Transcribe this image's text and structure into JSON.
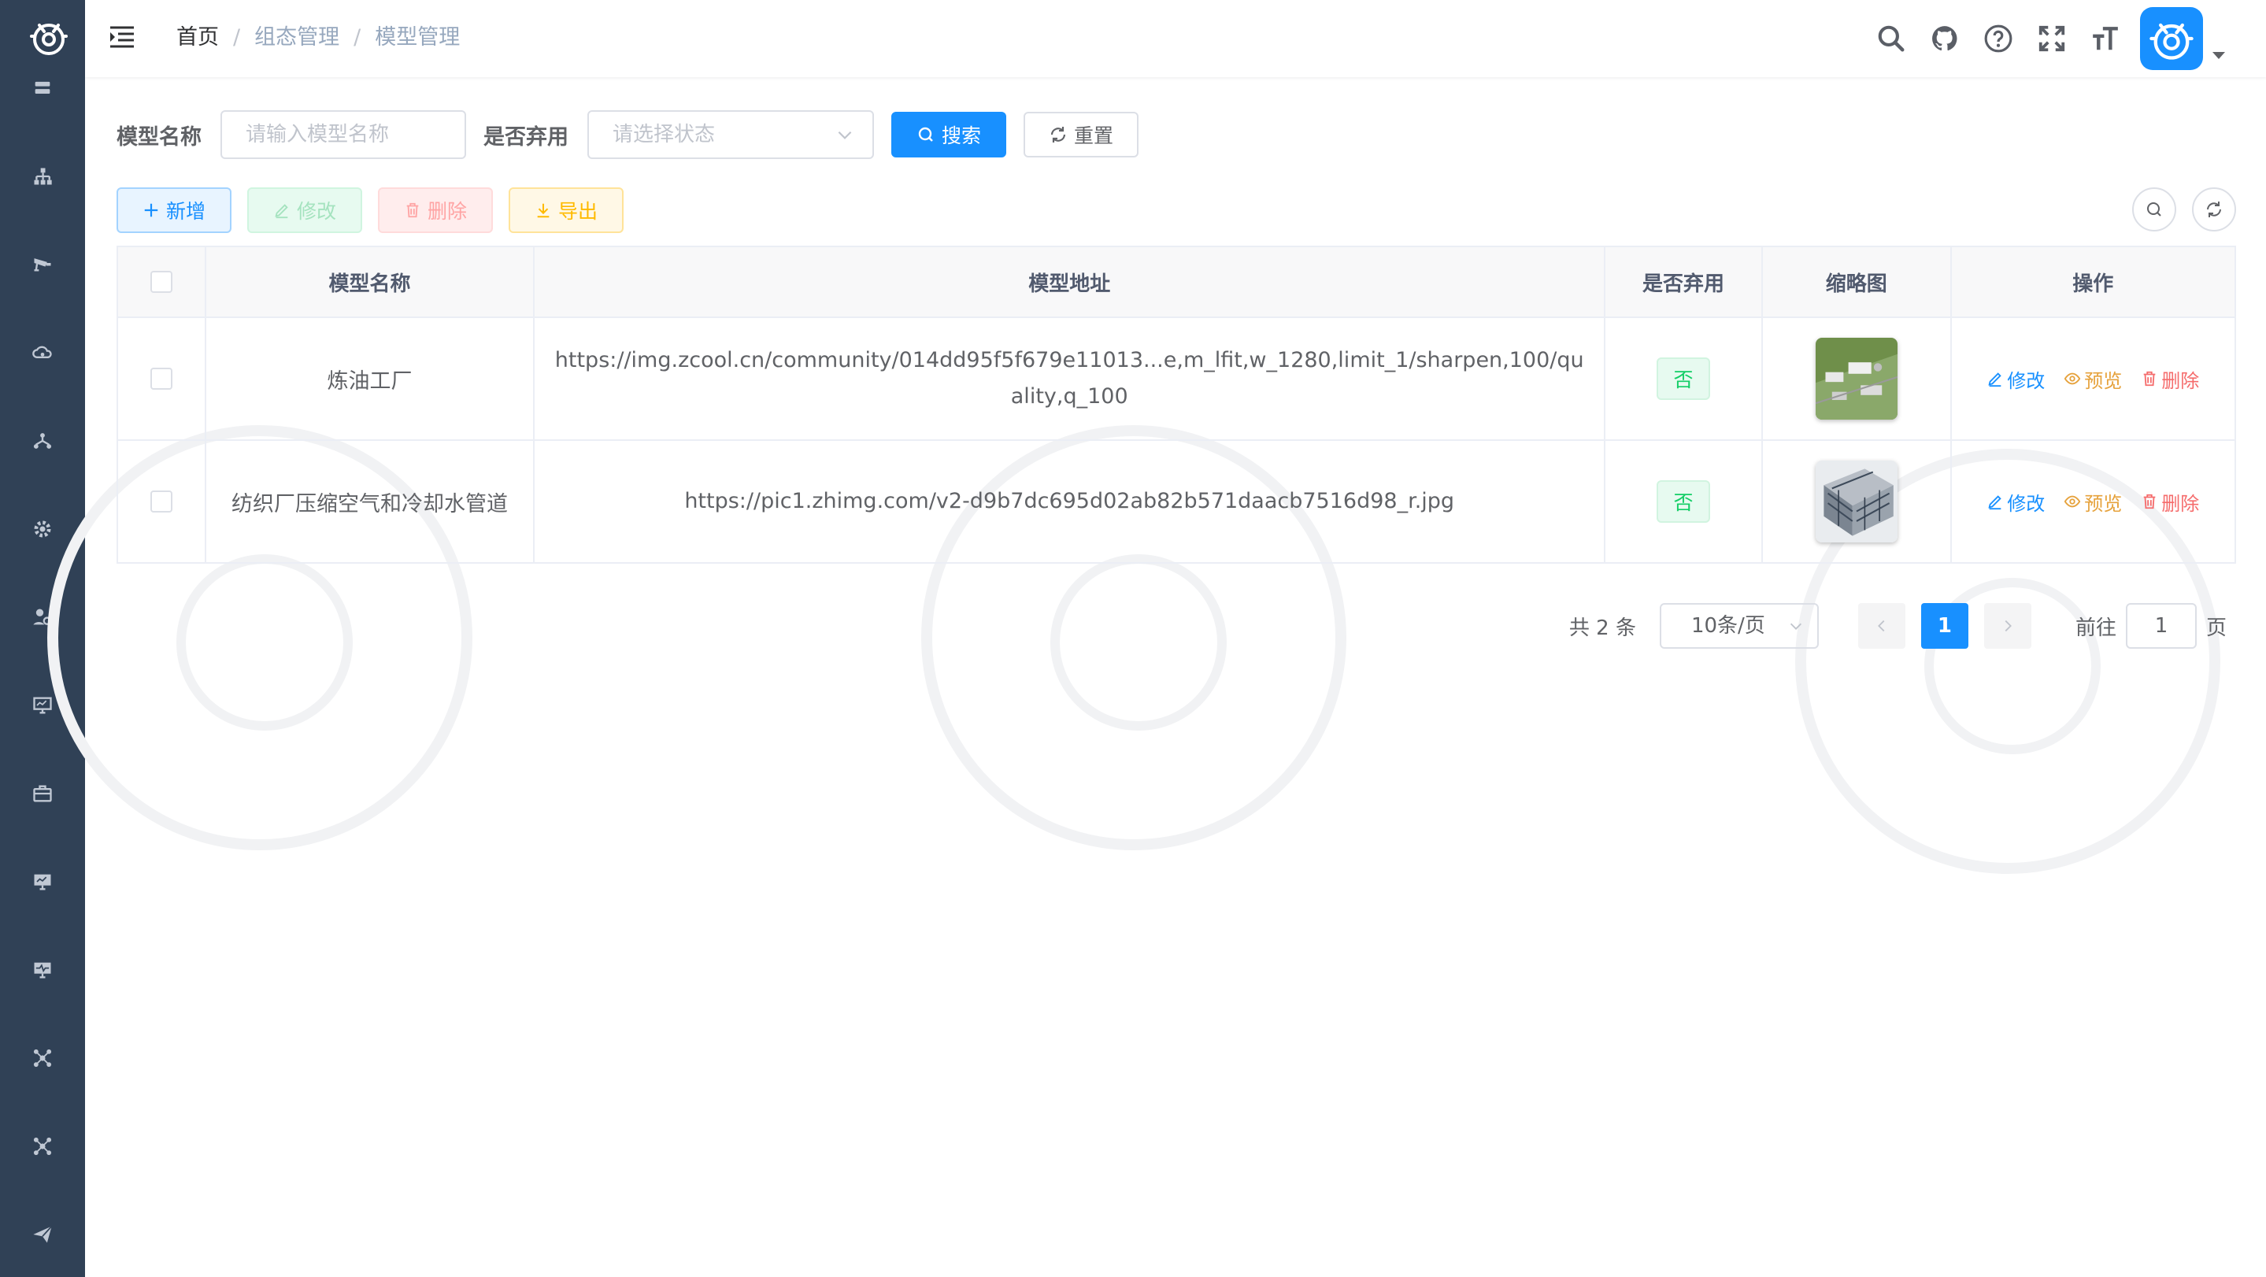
{
  "breadcrumb": [
    "首页",
    "组态管理",
    "模型管理"
  ],
  "search": {
    "name_label": "模型名称",
    "name_placeholder": "请输入模型名称",
    "status_label": "是否弃用",
    "status_placeholder": "请选择状态",
    "search_button": "搜索",
    "reset_button": "重置"
  },
  "toolbar": {
    "add": "新增",
    "edit": "修改",
    "delete": "删除",
    "export": "导出"
  },
  "table": {
    "headers": [
      "模型名称",
      "模型地址",
      "是否弃用",
      "缩略图",
      "操作"
    ],
    "rows": [
      {
        "name": "炼油工厂",
        "url": "https://img.zcool.cn/community/014dd95f5f679e11013...e,m_lfit,w_1280,limit_1/sharpen,100/quality,q_100",
        "deprecated": "否"
      },
      {
        "name": "纺织厂压缩空气和冷却水管道",
        "url": "https://pic1.zhimg.com/v2-d9b7dc695d02ab82b571daacb7516d98_r.jpg",
        "deprecated": "否"
      }
    ],
    "ops": {
      "edit": "修改",
      "preview": "预览",
      "delete": "删除"
    }
  },
  "pagination": {
    "total": "共 2 条",
    "page_size": "10条/页",
    "current": "1",
    "jump_prefix": "前往",
    "jump_value": "1",
    "jump_suffix": "页"
  },
  "colors": {
    "sidebar": "#304156",
    "primary": "#1890ff",
    "success": "#13ce66",
    "warning": "#e6a23c",
    "danger": "#f56c6c"
  },
  "icons": {
    "sidebar": [
      "logo-icon",
      "server-icon",
      "org-tree-icon",
      "cctv-icon",
      "cloud-icon",
      "network-icon",
      "gear-icon",
      "user-settings-icon",
      "monitor-icon",
      "briefcase-icon",
      "monitor-chart-icon",
      "monitor-pulse-icon",
      "nodes-icon",
      "nodes-icon",
      "send-icon"
    ],
    "header": [
      "hamburger-icon",
      "search-icon",
      "github-icon",
      "help-icon",
      "fullscreen-icon",
      "font-size-icon",
      "avatar"
    ]
  }
}
